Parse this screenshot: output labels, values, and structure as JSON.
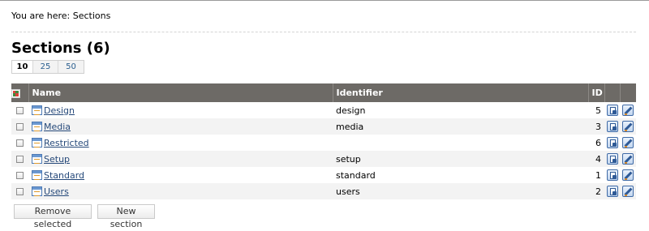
{
  "breadcrumb": {
    "text": "You are here: Sections"
  },
  "page": {
    "title": "Sections (6)"
  },
  "limits": {
    "options": [
      "10",
      "25",
      "50"
    ],
    "active": "10"
  },
  "table": {
    "columns": {
      "name": "Name",
      "identifier": "Identifier",
      "id": "ID"
    },
    "rows": [
      {
        "name": "Design",
        "identifier": "design",
        "id": "5"
      },
      {
        "name": "Media",
        "identifier": "media",
        "id": "3"
      },
      {
        "name": "Restricted",
        "identifier": "",
        "id": "6"
      },
      {
        "name": "Setup",
        "identifier": "setup",
        "id": "4"
      },
      {
        "name": "Standard",
        "identifier": "standard",
        "id": "1"
      },
      {
        "name": "Users",
        "identifier": "users",
        "id": "2"
      }
    ]
  },
  "actions": {
    "remove_label": "Remove selected",
    "new_label": "New section"
  },
  "icons": {
    "toggle": "invert-selection-icon",
    "section": "section-icon",
    "assign": "assign-icon",
    "edit": "edit-icon"
  },
  "colors": {
    "header_bg": "#6d6a66",
    "link": "#26497a",
    "row_alt": "#f3f3f3"
  }
}
